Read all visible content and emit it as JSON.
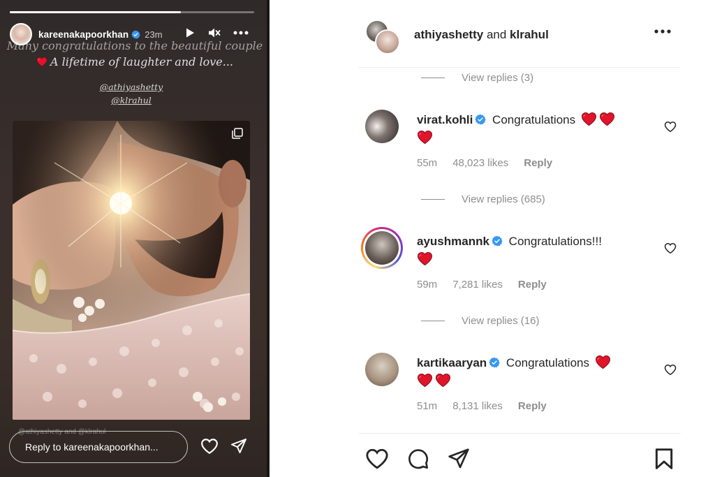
{
  "story": {
    "progress": 0.7,
    "username": "kareenakapoorkhan",
    "time": "23m",
    "caption_line1": "Many congratulations to the beautiful couple",
    "caption_line2": "A lifetime of laughter and love...",
    "tag1": "@athiyashetty",
    "tag2": "@klrahul",
    "mentions_overlay": "@athiyashetty and @klrahul",
    "reply_placeholder": "Reply to kareenakapoorkhan..."
  },
  "post": {
    "author1": "athiyashetty",
    "joiner": "and",
    "author2": "klrahul"
  },
  "replies_links": [
    {
      "label": "View replies (3)"
    },
    {
      "label": "View replies (685)"
    },
    {
      "label": "View replies (16)"
    }
  ],
  "comments": [
    {
      "username": "virat.kohli",
      "text": "Congratulations",
      "hearts": 3,
      "time": "55m",
      "likes": "48,023 likes",
      "reply": "Reply"
    },
    {
      "username": "ayushmannk",
      "text": "Congratulations!!!",
      "hearts": 1,
      "time": "59m",
      "likes": "7,281 likes",
      "reply": "Reply"
    },
    {
      "username": "kartikaaryan",
      "text": "Congratulations",
      "hearts": 3,
      "time": "51m",
      "likes": "8,131 likes",
      "reply": "Reply"
    }
  ],
  "icons": {
    "verified": "verified-badge-icon",
    "heart_red": "red-heart-emoji",
    "like": "heart-outline-icon",
    "comment": "comment-bubble-icon",
    "share": "paper-plane-icon",
    "save": "bookmark-icon",
    "more": "more-dots-icon",
    "play": "play-icon",
    "mute": "muted-speaker-icon"
  },
  "colors": {
    "verified_blue": "#3897f0",
    "heart_red": "#e0142b",
    "muted_text": "#8e8e8e",
    "text": "#262626"
  }
}
